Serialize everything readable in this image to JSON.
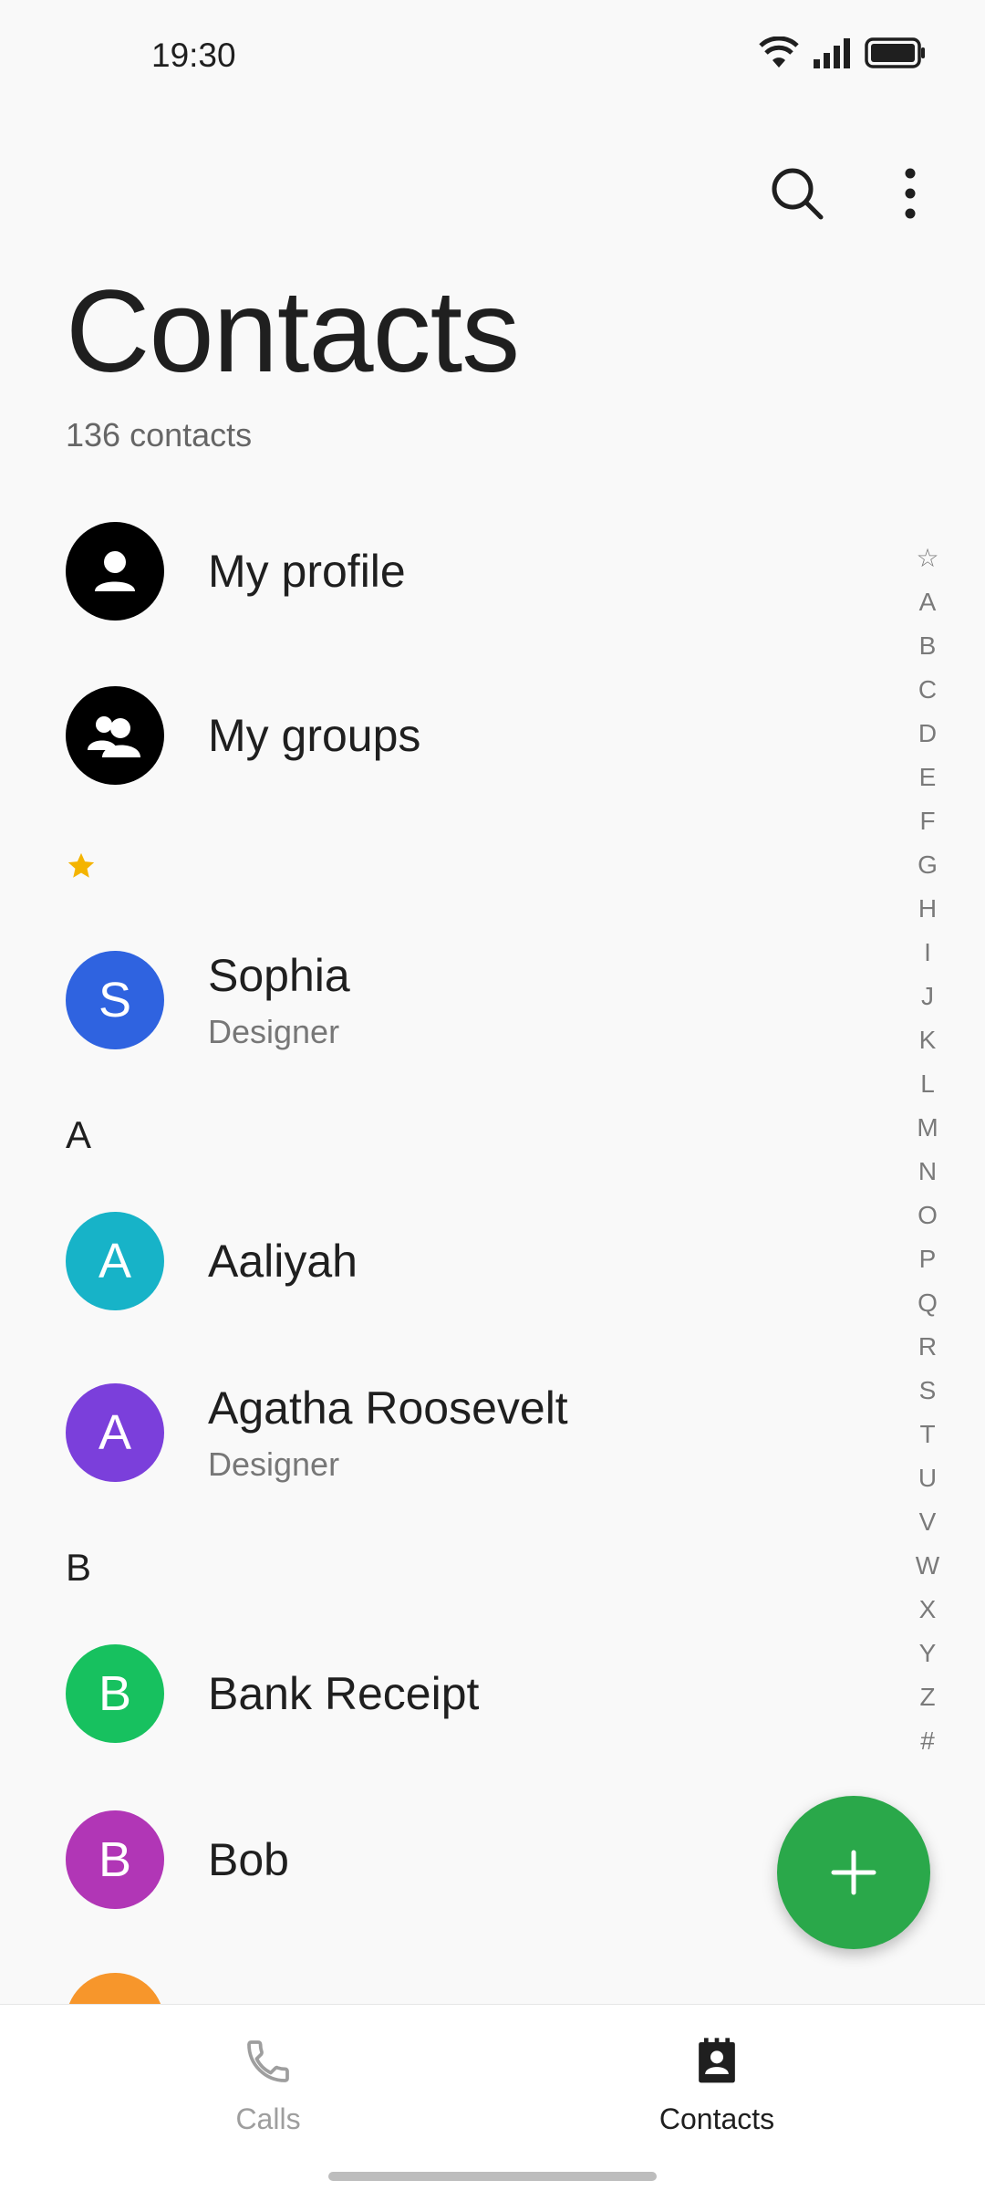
{
  "status": {
    "time": "19:30",
    "icons": [
      "wifi-icon",
      "signal-icon",
      "battery-icon"
    ]
  },
  "header": {
    "title": "Contacts",
    "count": "136 contacts",
    "actions": [
      "search-icon",
      "more-vert-icon"
    ]
  },
  "quick": {
    "profile_label": "My profile",
    "groups_label": "My groups"
  },
  "favorites": {
    "marker_icon": "star-icon",
    "contacts": [
      {
        "initial": "S",
        "name": "Sophia",
        "subtitle": "Designer",
        "color": "#2f63e0"
      }
    ]
  },
  "sections": [
    {
      "letter": "A",
      "contacts": [
        {
          "initial": "A",
          "name": "Aaliyah",
          "subtitle": "",
          "color": "#17b3c8"
        },
        {
          "initial": "A",
          "name": "Agatha Roosevelt",
          "subtitle": "Designer",
          "color": "#7b3fdb"
        }
      ]
    },
    {
      "letter": "B",
      "contacts": [
        {
          "initial": "B",
          "name": "Bank Receipt",
          "subtitle": "",
          "color": "#17c15f"
        },
        {
          "initial": "B",
          "name": "Bob",
          "subtitle": "",
          "color": "#b136b6"
        }
      ]
    }
  ],
  "partial_avatar_color": "#f7962b",
  "alpha_index": [
    "☆",
    "A",
    "B",
    "C",
    "D",
    "E",
    "F",
    "G",
    "H",
    "I",
    "J",
    "K",
    "L",
    "M",
    "N",
    "O",
    "P",
    "Q",
    "R",
    "S",
    "T",
    "U",
    "V",
    "W",
    "X",
    "Y",
    "Z",
    "#"
  ],
  "fab": {
    "icon": "plus-icon",
    "color": "#2aa84a"
  },
  "bottom_nav": [
    {
      "label": "Calls",
      "icon": "phone-icon",
      "active": false
    },
    {
      "label": "Contacts",
      "icon": "contact-card-icon",
      "active": true
    }
  ]
}
